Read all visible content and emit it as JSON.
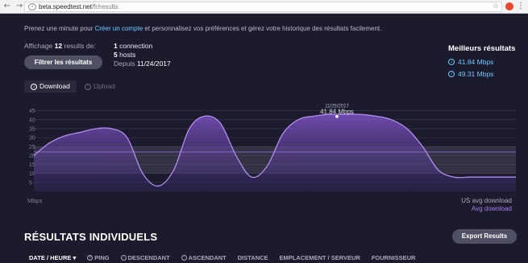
{
  "browser": {
    "url_host": "beta.speedtest.net",
    "url_path": "/fr/results"
  },
  "prompt": {
    "before": "Prenez une minute pour ",
    "link": "Créer un compte",
    "after": " et personnalisez vos préférences et gérez votre historique des résultats facilement."
  },
  "summary": {
    "display_label": "Affichage",
    "display_count": "12",
    "display_suffix": "results de:",
    "connection_count": "1",
    "connection_label": "connection",
    "hosts_count": "5",
    "hosts_label": "hosts",
    "since_label": "Depuis",
    "since_date": "11/24/2017",
    "filter_button": "Filtrer les résultats"
  },
  "best": {
    "title": "Meilleurs résultats",
    "values": [
      "41.84 Mbps",
      "49.31 Mbps"
    ]
  },
  "tabs": {
    "download": "Download",
    "upload": "Upload"
  },
  "chart_data": {
    "type": "area",
    "y_ticks": [
      5,
      10,
      15,
      20,
      25,
      30,
      35,
      40,
      45
    ],
    "ylim": [
      0,
      48
    ],
    "unit": "Mbps",
    "series": [
      {
        "values": [
          20,
          27,
          31,
          33,
          35,
          35,
          30,
          10,
          3,
          12,
          35,
          42,
          38,
          20,
          8,
          14,
          32,
          40,
          42,
          43,
          43,
          43,
          42,
          40,
          35,
          25,
          12,
          8,
          8,
          8,
          8,
          8
        ]
      }
    ],
    "us_avg_band": [
      10,
      25
    ],
    "avg_line": 22,
    "annotation": {
      "date": "11/25/2017",
      "value": "41.84 Mbps"
    },
    "legend": [
      "US avg download",
      "Avg download"
    ]
  },
  "results": {
    "title": "RÉSULTATS INDIVIDUELS",
    "export_button": "Export Results",
    "columns": [
      "DATE / HEURE",
      "PING",
      "DESCENDANT",
      "ASCENDANT",
      "DISTANCE",
      "EMPLACEMENT / SERVEUR",
      "FOURNISSEUR"
    ]
  }
}
